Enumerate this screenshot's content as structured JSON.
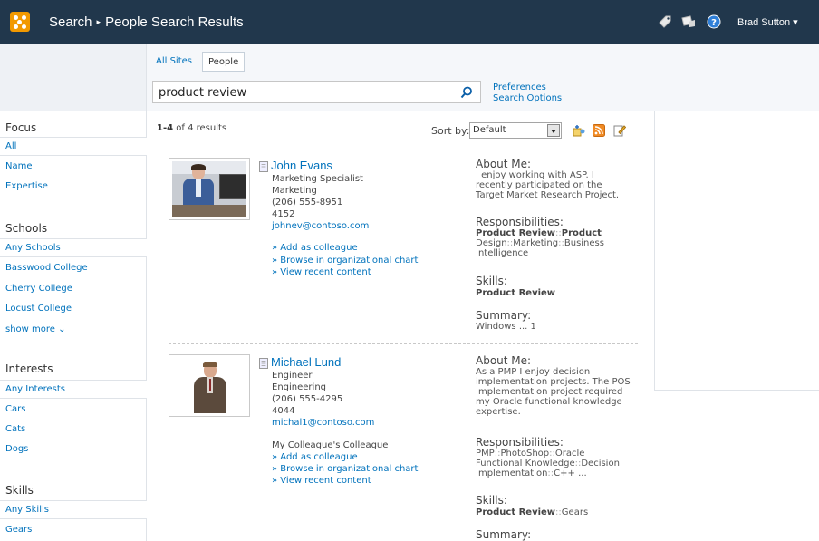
{
  "topbar": {
    "crumb_root": "Search",
    "crumb_sep": "▸",
    "crumb_page": "People Search Results",
    "user_name": "Brad Sutton",
    "user_caret": "▾"
  },
  "search": {
    "tabs": [
      "All Sites",
      "People"
    ],
    "query": "product review",
    "preferences": "Preferences",
    "search_options": "Search Options"
  },
  "nav": {
    "focus_title": "Focus",
    "focus_items": [
      "All",
      "Name",
      "Expertise"
    ],
    "schools_title": "Schools",
    "schools_items": [
      "Any Schools",
      "Basswood College",
      "Cherry College",
      "Locust College",
      "show more ⌄"
    ],
    "interests_title": "Interests",
    "interests_items": [
      "Any Interests",
      "Cars",
      "Cats",
      "Dogs"
    ],
    "skills_title": "Skills",
    "skills_items": [
      "Any Skills",
      "Gears"
    ]
  },
  "results": {
    "count_range": "1-4",
    "count_rest": " of 4 results",
    "sort_label": "Sort by:",
    "sort_value": "Default"
  },
  "people": [
    {
      "name": "John Evans",
      "title": "Marketing Specialist",
      "department": "Marketing",
      "phone": "(206) 555-8951",
      "extension": "4152",
      "email": "johnev@contoso.com",
      "note": "",
      "actions": [
        "» Add as colleague",
        "» Browse in organizational chart",
        "» View recent content"
      ],
      "about_head": "About Me:",
      "about": [
        "I enjoy working with ASP. I",
        "recently participated on the",
        "Target Market Research Project."
      ],
      "resp_head": "Responsibilities:",
      "resp": [
        "Product Review",
        "::",
        "Product",
        "Design",
        "::",
        "Marketing",
        "::",
        "Business",
        "Intelligence"
      ],
      "skills_head": "Skills:",
      "skills": "Product Review",
      "summary_head": "Summary:",
      "summary": "Windows ... 1"
    },
    {
      "name": "Michael Lund",
      "title": "Engineer",
      "department": "Engineering",
      "phone": "(206) 555-4295",
      "extension": "4044",
      "email": "michal1@contoso.com",
      "note": "My Colleague's Colleague",
      "actions": [
        "» Add as colleague",
        "» Browse in organizational chart",
        "» View recent content"
      ],
      "about_head": "About Me:",
      "about": [
        "As a PMP I enjoy decision",
        "implementation projects. The POS",
        "Implementation project required",
        "my Oracle functional knowledge",
        "expertise."
      ],
      "resp_head": "Responsibilities:",
      "resp": [
        "PMP",
        "::",
        "PhotoShop",
        "::",
        "Oracle",
        "Functional Knowledge",
        "::",
        "Decision",
        "Implementation",
        "::",
        "C++",
        "..."
      ],
      "skills_head": "Skills:",
      "skills": "Product Review",
      "skills_extra": "::",
      "skills_extra2": "Gears",
      "summary_head": "Summary:"
    }
  ],
  "colors": {
    "topbar": "#21374c",
    "link": "#0072bc",
    "logo": "#f29900"
  }
}
